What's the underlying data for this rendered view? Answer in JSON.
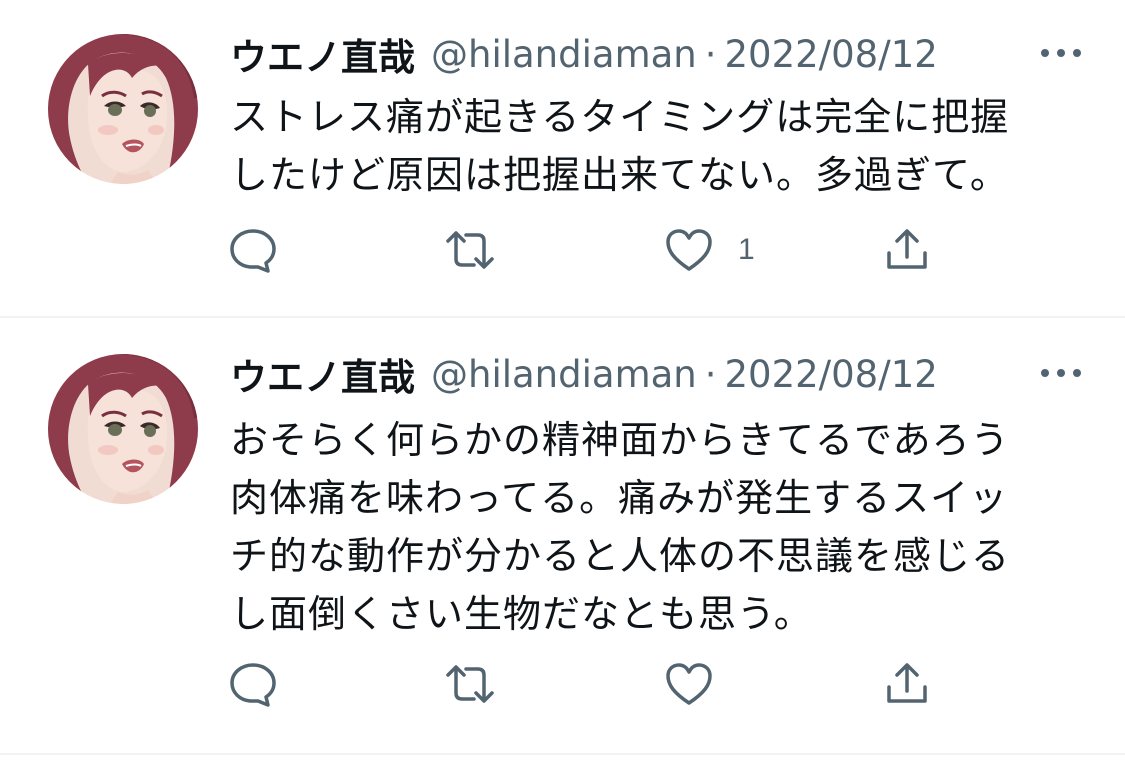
{
  "tweets": [
    {
      "author_name": "ウエノ直哉",
      "handle": "@hilandiaman",
      "separator": "·",
      "date": "2022/08/12",
      "text_lines": [
        "ストレス痛が起きるタイミングは完全に把握",
        "したけど原因は把握出来てない。多過ぎて。"
      ],
      "like_count": "1",
      "icons": [
        "reply-icon",
        "retweet-icon",
        "like-icon",
        "share-icon",
        "more-icon"
      ]
    },
    {
      "author_name": "ウエノ直哉",
      "handle": "@hilandiaman",
      "separator": "·",
      "date": "2022/08/12",
      "text_lines": [
        "おそらく何らかの精神面からきてるであろう",
        "肉体痛を味わってる。痛みが発生するスイッ",
        "チ的な動作が分かると人体の不思議を感じる",
        "し面倒くさい生物だなとも思う。"
      ],
      "like_count": "",
      "icons": [
        "reply-icon",
        "retweet-icon",
        "like-icon",
        "share-icon",
        "more-icon"
      ]
    }
  ],
  "colors": {
    "text": "#0f1419",
    "secondary": "#536471",
    "divider": "#eff3f4",
    "avatar_hair": "#8e3b4c"
  }
}
